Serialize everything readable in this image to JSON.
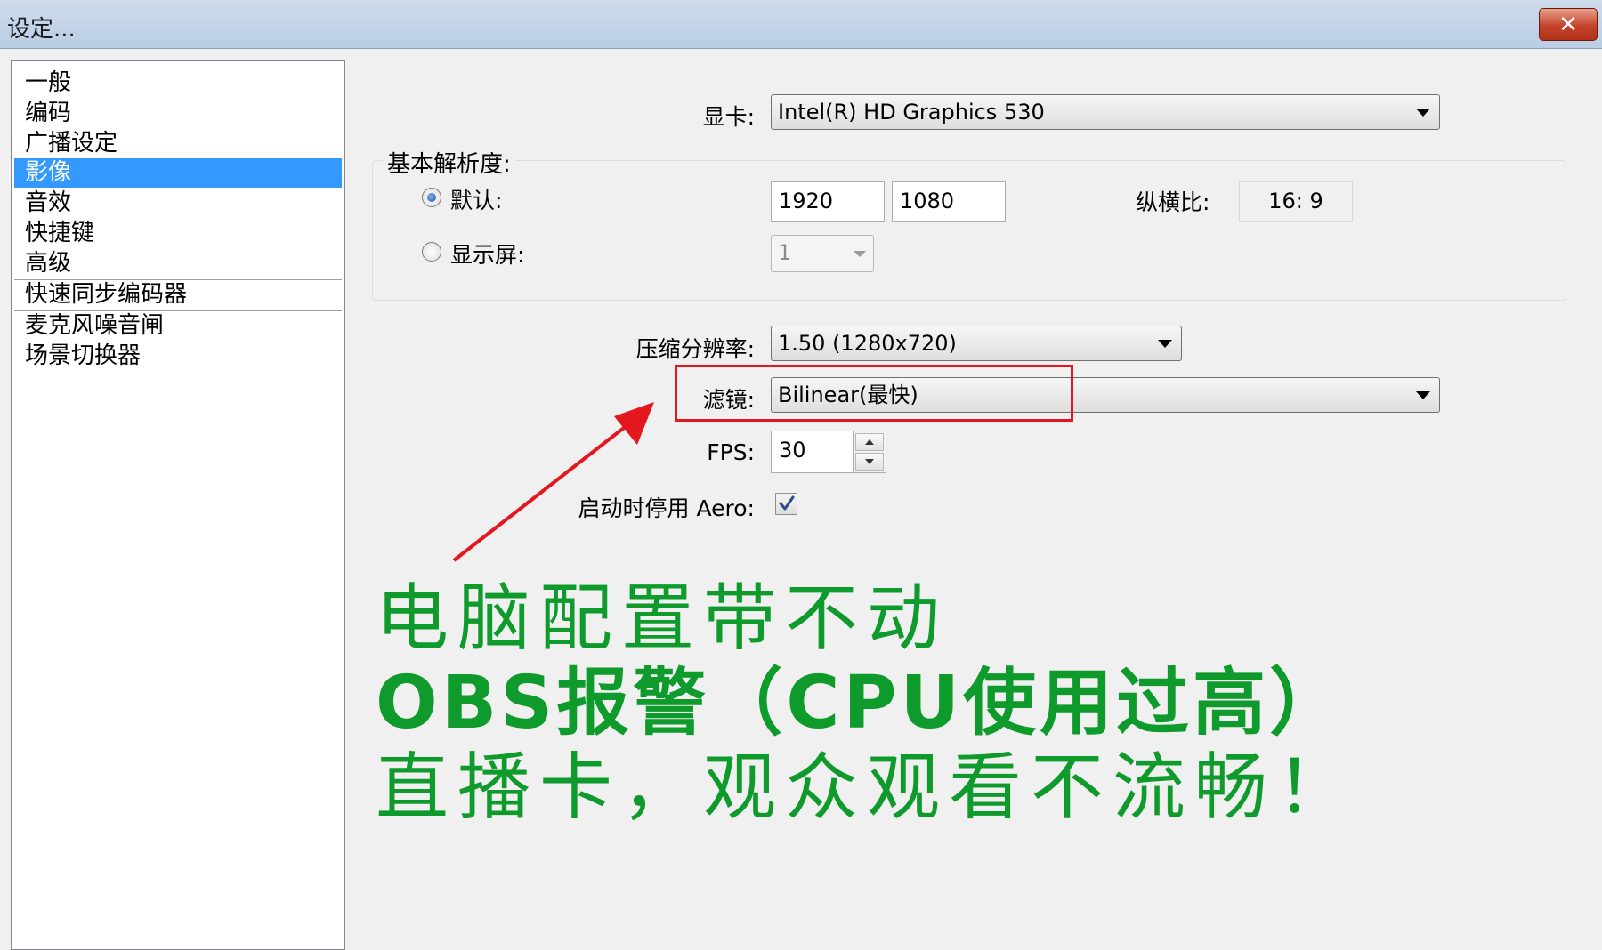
{
  "window": {
    "title": "设定...",
    "close_icon": "close-icon"
  },
  "sidebar": {
    "items": [
      {
        "label": "一般"
      },
      {
        "label": "编码"
      },
      {
        "label": "广播设定"
      },
      {
        "label": "影像",
        "selected": true
      },
      {
        "label": "音效"
      },
      {
        "label": "快捷键"
      },
      {
        "label": "高级"
      },
      {
        "label": "快速同步编码器"
      },
      {
        "label": "麦克风噪音闸"
      },
      {
        "label": "场景切换器"
      }
    ]
  },
  "video": {
    "gpu_label": "显卡:",
    "gpu_value": "Intel(R) HD Graphics 530",
    "base_res_group": "基本解析度:",
    "default_label": "默认:",
    "width": "1920",
    "height": "1080",
    "aspect_label": "纵横比:",
    "aspect_value": "16: 9",
    "monitor_label": "显示屏:",
    "monitor_value": "1",
    "downscale_label": "压缩分辨率:",
    "downscale_value": "1.50 (1280x720)",
    "filter_label": "滤镜:",
    "filter_value": "Bilinear(最快)",
    "fps_label": "FPS:",
    "fps_value": "30",
    "aero_label": "启动时停用 Aero:",
    "aero_checked": true
  },
  "annotation": {
    "line1": "电脑配置带不动",
    "line2": "OBS报警（CPU使用过高）",
    "line3": "直播卡，观众观看不流畅！",
    "text_color": "#0f9a2c",
    "highlight_color": "#e4161e"
  }
}
